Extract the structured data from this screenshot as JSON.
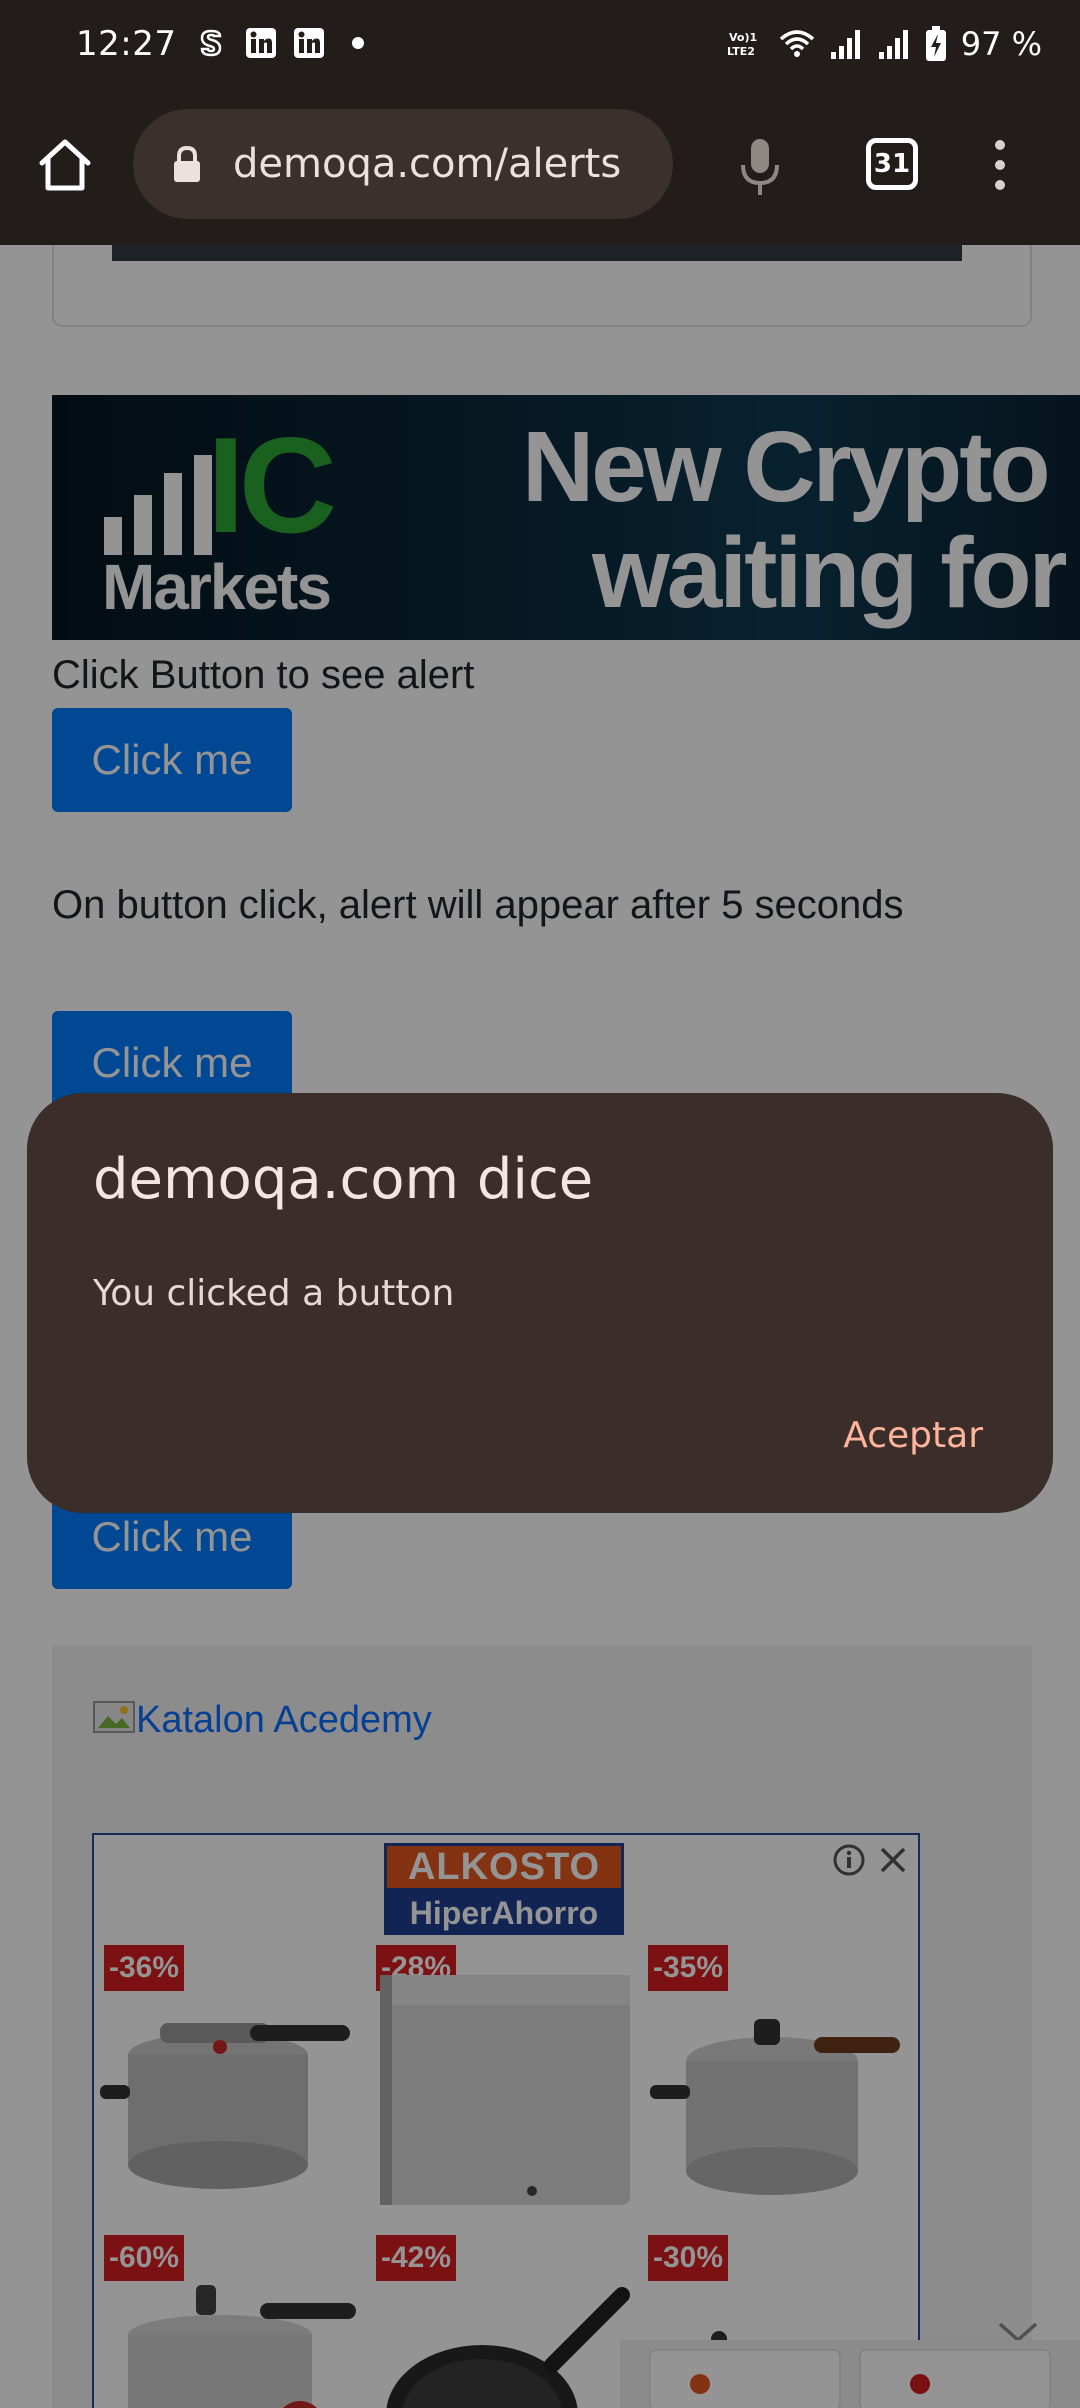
{
  "status_bar": {
    "time": "12:27",
    "battery_percent": "97 %",
    "notification_icons": [
      "strava-icon",
      "linkedin-icon",
      "linkedin-icon",
      "dot-icon"
    ],
    "network_label": "VoLTE2"
  },
  "browser": {
    "url": "demoqa.com/alerts",
    "tab_count": "31"
  },
  "page": {
    "banner": {
      "logo_top": "IC",
      "logo_bottom": "Markets",
      "headline_line1": "New Crypto",
      "headline_line2": "waiting for"
    },
    "alerts": [
      {
        "label": "Click Button to see alert",
        "button": "Click me"
      },
      {
        "label": "On button click, alert will appear after 5 seconds",
        "button": "Click me"
      },
      {
        "label": "",
        "button": "Click me"
      }
    ],
    "katalon_link": "Katalon Acedemy",
    "ad": {
      "brand_top": "ALKOSTO",
      "brand_bottom": "HiperAhorro",
      "products": [
        {
          "discount": "-36%",
          "item": "pressure-cooker"
        },
        {
          "discount": "-28%",
          "item": "mini-fridge"
        },
        {
          "discount": "-35%",
          "item": "pressure-cooker"
        },
        {
          "discount": "-60%",
          "item": "pressure-cooker"
        },
        {
          "discount": "-42%",
          "item": "frying-pan"
        },
        {
          "discount": "-30%",
          "item": "cookware-set"
        }
      ]
    }
  },
  "dialog": {
    "title": "demoqa.com dice",
    "message": "You clicked a button",
    "accept_label": "Aceptar"
  },
  "colors": {
    "chrome_bg": "#221c1a",
    "dialog_bg": "#3b2d29",
    "accent": "#ffb59c",
    "button_primary": "#007bff"
  }
}
